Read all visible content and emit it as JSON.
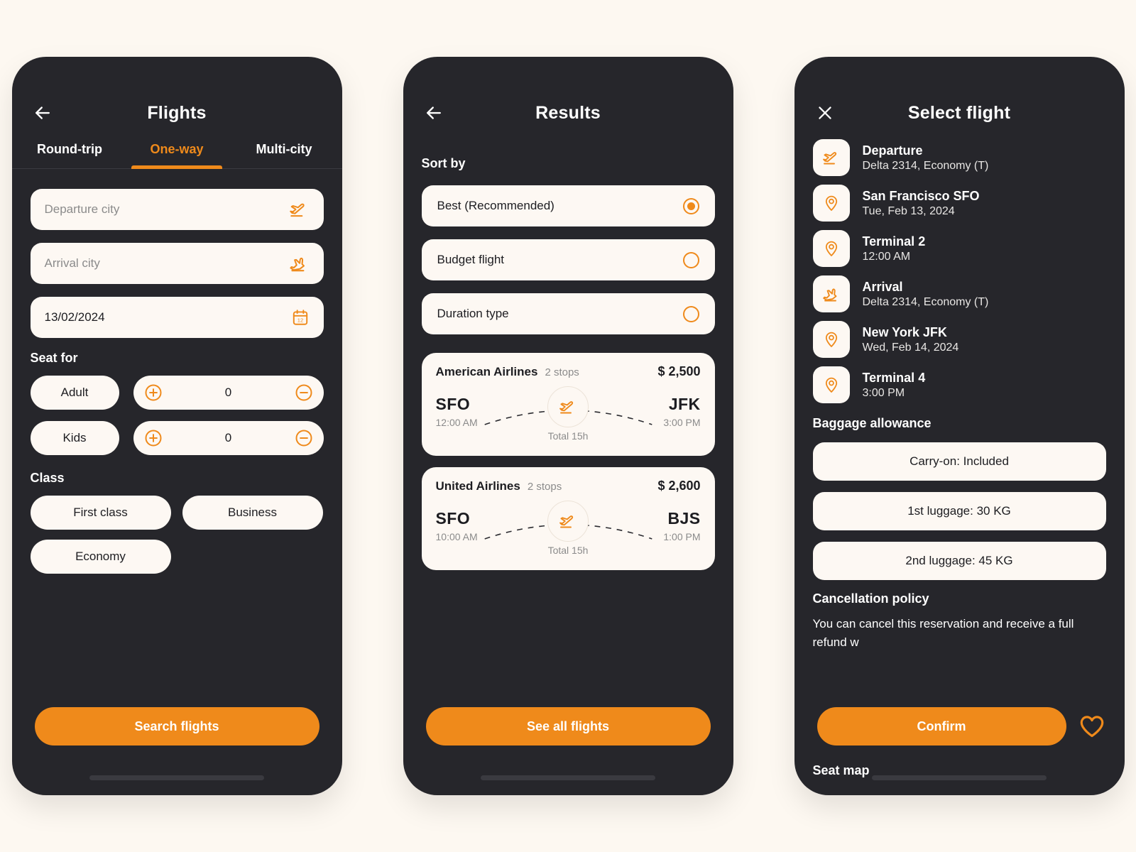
{
  "theme": {
    "page_bg": "#fdf8f1",
    "phone_bg": "#26262b",
    "card_bg": "#fdf8f3",
    "accent": "#ef8a1b",
    "text_dark": "#1d1d21",
    "text_muted": "#8b8b8b"
  },
  "screen1": {
    "title": "Flights",
    "back_icon": "arrow-left-icon",
    "tabs": [
      {
        "label": "Round-trip",
        "active": false
      },
      {
        "label": "One-way",
        "active": true
      },
      {
        "label": "Multi-city",
        "active": false
      }
    ],
    "fields": [
      {
        "placeholder": "Departure city",
        "value": "",
        "icon": "plane-takeoff-icon"
      },
      {
        "placeholder": "Arrival city",
        "value": "",
        "icon": "plane-landing-icon"
      },
      {
        "placeholder": "",
        "value": "13/02/2024",
        "icon": "calendar-icon"
      }
    ],
    "seat_for": {
      "title": "Seat for",
      "rows": [
        {
          "label": "Adult",
          "count": "0",
          "plus": "plus-circle-icon",
          "minus": "minus-circle-icon"
        },
        {
          "label": "Kids",
          "count": "0",
          "plus": "plus-circle-icon",
          "minus": "minus-circle-icon"
        }
      ]
    },
    "class": {
      "title": "Class",
      "options": [
        "First class",
        "Business",
        "Economy"
      ]
    },
    "primary_button": "Search flights"
  },
  "screen2": {
    "title": "Results",
    "back_icon": "arrow-left-icon",
    "sort_title": "Sort by",
    "sort_options": [
      {
        "label": "Best (Recommended)",
        "selected": true
      },
      {
        "label": "Budget flight",
        "selected": false
      },
      {
        "label": "Duration type",
        "selected": false
      }
    ],
    "flights": [
      {
        "airline": "American Airlines",
        "stops": "2 stops",
        "price": "$ 2,500",
        "from_code": "SFO",
        "from_time": "12:00 AM",
        "to_code": "JFK",
        "to_time": "3:00 PM",
        "duration": "Total 15h",
        "icon": "plane-takeoff-icon"
      },
      {
        "airline": "United Airlines",
        "stops": "2 stops",
        "price": "$ 2,600",
        "from_code": "SFO",
        "from_time": "10:00 AM",
        "to_code": "BJS",
        "to_time": "1:00 PM",
        "duration": "Total 15h",
        "icon": "plane-takeoff-icon"
      }
    ],
    "primary_button": "See all flights"
  },
  "screen3": {
    "title": "Select flight",
    "close_icon": "close-icon",
    "details": [
      {
        "icon": "plane-takeoff-icon",
        "title": "Departure",
        "subtitle": "Delta 2314, Economy (T)"
      },
      {
        "icon": "location-pin-icon",
        "title": "San Francisco SFO",
        "subtitle": "Tue, Feb 13, 2024"
      },
      {
        "icon": "location-pin-icon",
        "title": "Terminal 2",
        "subtitle": "12:00 AM"
      },
      {
        "icon": "plane-landing-icon",
        "title": "Arrival",
        "subtitle": "Delta 2314, Economy (T)"
      },
      {
        "icon": "location-pin-icon",
        "title": "New York JFK",
        "subtitle": "Wed, Feb 14, 2024"
      },
      {
        "icon": "location-pin-icon",
        "title": "Terminal 4",
        "subtitle": "3:00 PM"
      }
    ],
    "baggage": {
      "title": "Baggage allowance",
      "items": [
        "Carry-on: Included",
        "1st luggage: 30 KG",
        "2nd luggage: 45 KG"
      ]
    },
    "cancellation": {
      "title": "Cancellation policy",
      "text": "You can cancel this reservation and receive a full refund w"
    },
    "seat_map_label": "Seat map",
    "confirm_button": "Confirm",
    "favorite_icon": "heart-icon"
  }
}
